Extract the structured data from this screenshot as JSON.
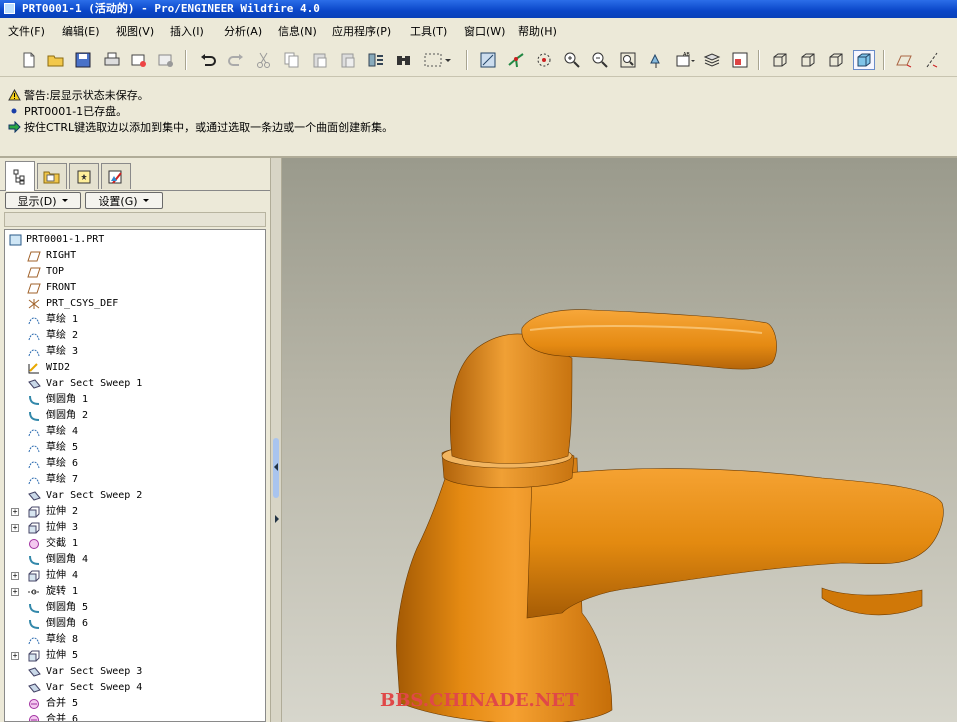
{
  "window": {
    "title": "PRT0001-1 (活动的) - Pro/ENGINEER Wildfire 4.0"
  },
  "menu": [
    "文件(F)",
    "编辑(E)",
    "视图(V)",
    "插入(I)",
    "分析(A)",
    "信息(N)",
    "应用程序(P)",
    "工具(T)",
    "窗口(W)",
    "帮助(H)"
  ],
  "messages": [
    {
      "icon": "warning-icon",
      "text": "警告:层显示状态未保存。"
    },
    {
      "icon": "bullet-icon",
      "text": "PRT0001-1已存盘。"
    },
    {
      "icon": "arrow-icon",
      "text": "按住CTRL键选取边以添加到集中，或通过选取一条边或一个曲面创建新集。"
    }
  ],
  "panel": {
    "show_button": "显示(D)",
    "settings_button": "设置(G)"
  },
  "tree": [
    {
      "label": "PRT0001-1.PRT",
      "icon": "part-icon",
      "expander": false
    },
    {
      "label": "RIGHT",
      "icon": "datum-plane-icon",
      "expander": false
    },
    {
      "label": "TOP",
      "icon": "datum-plane-icon",
      "expander": false
    },
    {
      "label": "FRONT",
      "icon": "datum-plane-icon",
      "expander": false
    },
    {
      "label": "PRT_CSYS_DEF",
      "icon": "csys-icon",
      "expander": false
    },
    {
      "label": "草绘 1",
      "icon": "sketch-icon",
      "expander": false
    },
    {
      "label": "草绘 2",
      "icon": "sketch-icon",
      "expander": false
    },
    {
      "label": "草绘 3",
      "icon": "sketch-icon",
      "expander": false
    },
    {
      "label": "WID2",
      "icon": "curve-icon",
      "expander": false
    },
    {
      "label": "Var Sect Sweep 1",
      "icon": "sweep-icon",
      "expander": false
    },
    {
      "label": "倒圆角 1",
      "icon": "round-icon",
      "expander": false
    },
    {
      "label": "倒圆角 2",
      "icon": "round-icon",
      "expander": false
    },
    {
      "label": "草绘 4",
      "icon": "sketch-icon",
      "expander": false
    },
    {
      "label": "草绘 5",
      "icon": "sketch-icon",
      "expander": false
    },
    {
      "label": "草绘 6",
      "icon": "sketch-icon",
      "expander": false
    },
    {
      "label": "草绘 7",
      "icon": "sketch-icon",
      "expander": false
    },
    {
      "label": "Var Sect Sweep 2",
      "icon": "sweep-icon",
      "expander": false
    },
    {
      "label": "拉伸 2",
      "icon": "extrude-icon",
      "expander": true
    },
    {
      "label": "拉伸 3",
      "icon": "extrude-icon",
      "expander": true
    },
    {
      "label": "交截 1",
      "icon": "intersect-icon",
      "expander": false
    },
    {
      "label": "倒圆角 4",
      "icon": "round-icon",
      "expander": false
    },
    {
      "label": "拉伸 4",
      "icon": "extrude-icon",
      "expander": true
    },
    {
      "label": "旋转 1",
      "icon": "revolve-icon",
      "expander": true
    },
    {
      "label": "倒圆角 5",
      "icon": "round-icon",
      "expander": false
    },
    {
      "label": "倒圆角 6",
      "icon": "round-icon",
      "expander": false
    },
    {
      "label": "草绘 8",
      "icon": "sketch-icon",
      "expander": false
    },
    {
      "label": "拉伸 5",
      "icon": "extrude-icon",
      "expander": true
    },
    {
      "label": "Var Sect Sweep 3",
      "icon": "sweep-icon",
      "expander": false
    },
    {
      "label": "Var Sect Sweep 4",
      "icon": "sweep-icon",
      "expander": false
    },
    {
      "label": "合并 5",
      "icon": "merge-icon",
      "expander": false
    },
    {
      "label": "合并 6",
      "icon": "merge-icon",
      "expander": false
    }
  ],
  "viewport": {
    "model_color": "#e38a10",
    "watermark": "BBS.CHINADE.NET"
  }
}
